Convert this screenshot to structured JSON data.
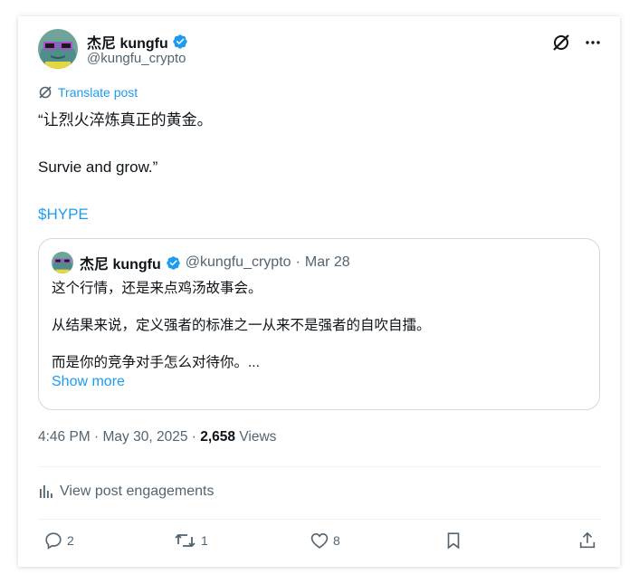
{
  "author": {
    "name": "杰尼 kungfu",
    "handle": "@kungfu_crypto"
  },
  "translate_label": "Translate post",
  "tweet": {
    "line1": "“让烈火淬炼真正的黄金。",
    "line2": "Survie and grow.”",
    "cashtag": "$HYPE"
  },
  "quote": {
    "name": "杰尼 kungfu",
    "handle": "@kungfu_crypto",
    "separator": "·",
    "date": "Mar 28",
    "line1": "这个行情，还是来点鸡汤故事会。",
    "line2": "从结果来说，定义强者的标准之一从来不是强者的自吹自擂。",
    "line3": "而是你的竞争对手怎么对待你。...",
    "show_more": "Show more"
  },
  "meta": {
    "time": "4:46 PM",
    "sep1": " · ",
    "date": "May 30, 2025",
    "sep2": " · ",
    "views_count": "2,658",
    "views_label": " Views"
  },
  "engagements_label": "View post engagements",
  "actions": {
    "replies": "2",
    "reposts": "1",
    "likes": "8"
  },
  "colors": {
    "accent": "#1d9bf0",
    "secondary_text": "#536471",
    "border": "#cfd9de",
    "verified": "#1d9bf0"
  },
  "icons": [
    "verified-badge-icon",
    "grok-icon",
    "more-icon",
    "translate-icon",
    "analytics-icon",
    "reply-icon",
    "repost-icon",
    "like-icon",
    "bookmark-icon",
    "share-icon"
  ]
}
